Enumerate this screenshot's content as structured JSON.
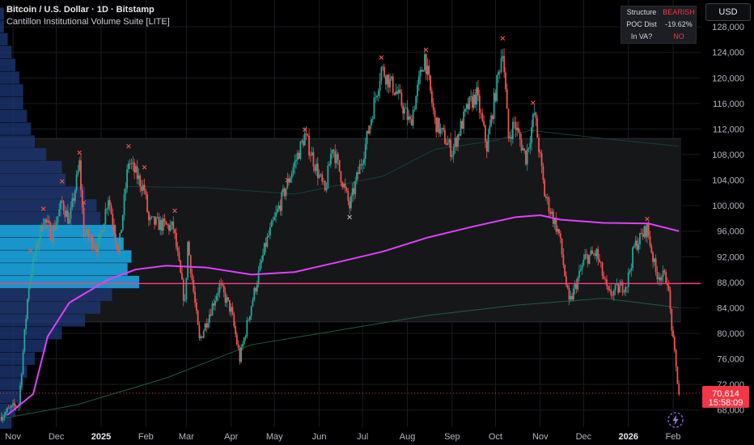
{
  "legend": {
    "symbol": "Bitcoin / U.S. Dollar · 1D · Bitstamp",
    "indicator": "Cantillon Institutional Volume Suite [LITE]"
  },
  "currency_button": "USD",
  "stats_table": [
    {
      "key": "Structure",
      "value": "BEARISH",
      "color": "#f23645"
    },
    {
      "key": "POC Dist",
      "value": "-19.62%",
      "color": "#d6d8de"
    },
    {
      "key": "In VA?",
      "value": "NO",
      "color": "#f23645"
    }
  ],
  "price_tag": {
    "price": "70,614",
    "countdown": "15:58:09",
    "color": "#f23645"
  },
  "colors": {
    "bg": "#000000",
    "grid": "#1a1c21",
    "up": "#26a69a",
    "down": "#ef5350",
    "vwap": "#e040fb",
    "poc": "#ff3d7f",
    "value_area": "#161719",
    "profile": "#1e3a7a",
    "profile_va": "#1ba3e0",
    "long_ma": "#1f5c44",
    "mid_ma": "#17403a"
  },
  "icons": {
    "bolt": "lightning-bolt-icon"
  },
  "chart_data": {
    "type": "candlestick",
    "x_labels": [
      "Nov",
      "Dec",
      "2025",
      "Feb",
      "Mar",
      "Apr",
      "May",
      "Jun",
      "Jul",
      "Aug",
      "Sep",
      "Oct",
      "Nov",
      "Dec",
      "2026",
      "Feb"
    ],
    "x_label_dates": [
      "2024-11-01",
      "2024-12-01",
      "2025-01-01",
      "2025-02-01",
      "2025-03-01",
      "2025-04-01",
      "2025-05-01",
      "2025-06-01",
      "2025-07-01",
      "2025-08-01",
      "2025-09-01",
      "2025-10-01",
      "2025-11-01",
      "2025-12-01",
      "2026-01-01",
      "2026-02-01"
    ],
    "x_range": [
      "2024-10-23",
      "2026-02-20"
    ],
    "y_ticks": [
      68000,
      72000,
      76000,
      80000,
      84000,
      88000,
      92000,
      96000,
      100000,
      104000,
      108000,
      112000,
      116000,
      120000,
      124000,
      128000
    ],
    "y_range": [
      65300,
      132200
    ],
    "last_price": 70614,
    "poc_level": 87800,
    "value_area": {
      "high": 110500,
      "low": 81800
    },
    "profile_highlight": {
      "high": 96600,
      "low": 86800
    },
    "price_path": [
      [
        "2024-10-23",
        67000
      ],
      [
        "2024-11-05",
        69000
      ],
      [
        "2024-11-12",
        88000
      ],
      [
        "2024-11-22",
        98000
      ],
      [
        "2024-11-28",
        95500
      ],
      [
        "2024-12-05",
        100500
      ],
      [
        "2024-12-10",
        97500
      ],
      [
        "2024-12-17",
        106500
      ],
      [
        "2024-12-20",
        95800
      ],
      [
        "2024-12-30",
        93500
      ],
      [
        "2025-01-06",
        101500
      ],
      [
        "2025-01-13",
        92500
      ],
      [
        "2025-01-20",
        107000
      ],
      [
        "2025-01-31",
        102500
      ],
      [
        "2025-02-03",
        97500
      ],
      [
        "2025-02-20",
        96500
      ],
      [
        "2025-02-28",
        84500
      ],
      [
        "2025-03-02",
        94200
      ],
      [
        "2025-03-10",
        78800
      ],
      [
        "2025-03-24",
        87500
      ],
      [
        "2025-04-01",
        83500
      ],
      [
        "2025-04-07",
        76000
      ],
      [
        "2025-04-15",
        84500
      ],
      [
        "2025-04-25",
        94000
      ],
      [
        "2025-05-10",
        103500
      ],
      [
        "2025-05-22",
        111000
      ],
      [
        "2025-06-05",
        102000
      ],
      [
        "2025-06-10",
        109500
      ],
      [
        "2025-06-22",
        99800
      ],
      [
        "2025-07-03",
        109500
      ],
      [
        "2025-07-14",
        121500
      ],
      [
        "2025-07-25",
        117500
      ],
      [
        "2025-08-03",
        112800
      ],
      [
        "2025-08-13",
        123500
      ],
      [
        "2025-08-20",
        113200
      ],
      [
        "2025-09-01",
        108500
      ],
      [
        "2025-09-12",
        115500
      ],
      [
        "2025-09-18",
        117300
      ],
      [
        "2025-09-25",
        109200
      ],
      [
        "2025-10-06",
        124800
      ],
      [
        "2025-10-10",
        110500
      ],
      [
        "2025-10-14",
        113000
      ],
      [
        "2025-10-22",
        107500
      ],
      [
        "2025-10-28",
        114500
      ],
      [
        "2025-11-04",
        101800
      ],
      [
        "2025-11-14",
        95500
      ],
      [
        "2025-11-21",
        84500
      ],
      [
        "2025-12-02",
        91800
      ],
      [
        "2025-12-10",
        92500
      ],
      [
        "2025-12-18",
        86000
      ],
      [
        "2025-12-31",
        87800
      ],
      [
        "2026-01-05",
        93500
      ],
      [
        "2026-01-14",
        96500
      ],
      [
        "2026-01-20",
        89500
      ],
      [
        "2026-01-28",
        88500
      ],
      [
        "2026-02-01",
        78500
      ],
      [
        "2026-02-05",
        70614
      ]
    ],
    "swing_high_markers": [
      [
        "2024-11-13",
        92900
      ],
      [
        "2024-11-22",
        99500
      ],
      [
        "2024-12-05",
        103800
      ],
      [
        "2024-12-17",
        108300
      ],
      [
        "2024-12-20",
        100500
      ],
      [
        "2025-01-20",
        109300
      ],
      [
        "2025-01-31",
        106000
      ],
      [
        "2025-02-21",
        99200
      ],
      [
        "2025-05-10",
        104000
      ],
      [
        "2025-05-22",
        111900
      ],
      [
        "2025-07-14",
        123200
      ],
      [
        "2025-08-14",
        124400
      ],
      [
        "2025-09-18",
        117900
      ],
      [
        "2025-10-06",
        126200
      ],
      [
        "2025-10-27",
        116100
      ],
      [
        "2026-01-14",
        97900
      ]
    ],
    "swing_low_markers": [
      [
        "2025-06-22",
        98200
      ]
    ],
    "vwap": [
      [
        "2024-10-28",
        67200
      ],
      [
        "2024-11-15",
        70500
      ],
      [
        "2024-11-25",
        79500
      ],
      [
        "2024-12-10",
        84800
      ],
      [
        "2025-01-05",
        88300
      ],
      [
        "2025-01-25",
        90000
      ],
      [
        "2025-02-15",
        90600
      ],
      [
        "2025-03-15",
        90300
      ],
      [
        "2025-04-15",
        89200
      ],
      [
        "2025-05-15",
        89600
      ],
      [
        "2025-06-15",
        91200
      ],
      [
        "2025-07-15",
        92800
      ],
      [
        "2025-08-15",
        95000
      ],
      [
        "2025-09-15",
        96700
      ],
      [
        "2025-10-15",
        98200
      ],
      [
        "2025-11-01",
        98500
      ],
      [
        "2025-11-15",
        97800
      ],
      [
        "2025-12-15",
        97300
      ],
      [
        "2026-01-15",
        97200
      ],
      [
        "2026-02-05",
        96000
      ]
    ],
    "long_ma": [
      [
        "2024-10-28",
        66800
      ],
      [
        "2024-12-15",
        68800
      ],
      [
        "2025-02-15",
        73000
      ],
      [
        "2025-04-15",
        78200
      ],
      [
        "2025-06-15",
        80500
      ],
      [
        "2025-08-15",
        82800
      ],
      [
        "2025-10-15",
        84400
      ],
      [
        "2025-12-15",
        85500
      ],
      [
        "2026-02-05",
        84000
      ]
    ],
    "mid_ma": [
      [
        "2025-01-20",
        103000
      ],
      [
        "2025-03-15",
        102800
      ],
      [
        "2025-05-15",
        101800
      ],
      [
        "2025-07-15",
        104600
      ],
      [
        "2025-08-20",
        108800
      ],
      [
        "2025-10-01",
        110200
      ],
      [
        "2025-10-25",
        111800
      ],
      [
        "2025-12-15",
        110500
      ],
      [
        "2026-02-05",
        109300
      ]
    ],
    "volume_profile": [
      {
        "price": 130000,
        "volume": 1
      },
      {
        "price": 128000,
        "volume": 1
      },
      {
        "price": 126000,
        "volume": 2
      },
      {
        "price": 124000,
        "volume": 3
      },
      {
        "price": 122000,
        "volume": 4
      },
      {
        "price": 120000,
        "volume": 5
      },
      {
        "price": 118000,
        "volume": 6
      },
      {
        "price": 116000,
        "volume": 6
      },
      {
        "price": 114000,
        "volume": 7
      },
      {
        "price": 112000,
        "volume": 8
      },
      {
        "price": 110000,
        "volume": 9
      },
      {
        "price": 108000,
        "volume": 12
      },
      {
        "price": 106000,
        "volume": 16
      },
      {
        "price": 104000,
        "volume": 17
      },
      {
        "price": 102000,
        "volume": 22
      },
      {
        "price": 100000,
        "volume": 25
      },
      {
        "price": 98000,
        "volume": 26
      },
      {
        "price": 96000,
        "volume": 30
      },
      {
        "price": 94000,
        "volume": 32
      },
      {
        "price": 92000,
        "volume": 34
      },
      {
        "price": 90000,
        "volume": 33
      },
      {
        "price": 88000,
        "volume": 36
      },
      {
        "price": 86000,
        "volume": 29
      },
      {
        "price": 84000,
        "volume": 26
      },
      {
        "price": 82000,
        "volume": 22
      },
      {
        "price": 80000,
        "volume": 16
      },
      {
        "price": 78000,
        "volume": 12
      },
      {
        "price": 76000,
        "volume": 9
      },
      {
        "price": 74000,
        "volume": 7
      },
      {
        "price": 72000,
        "volume": 6
      },
      {
        "price": 70000,
        "volume": 5
      },
      {
        "price": 68000,
        "volume": 4
      },
      {
        "price": 66000,
        "volume": 3
      }
    ]
  }
}
